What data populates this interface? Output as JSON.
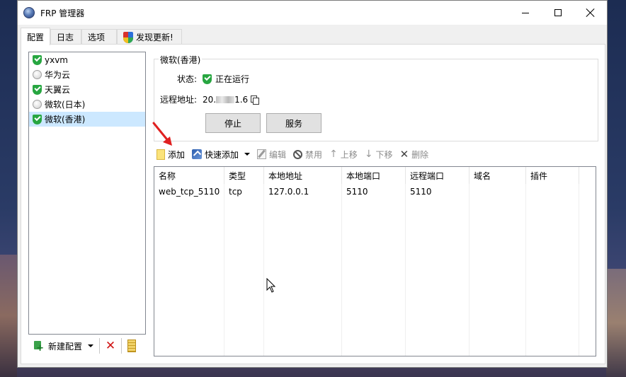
{
  "window": {
    "title": "FRP 管理器"
  },
  "tabs": [
    {
      "label": "配置"
    },
    {
      "label": "日志"
    },
    {
      "label": "选项"
    },
    {
      "label": "发现更新!"
    }
  ],
  "config_list": [
    {
      "name": "yxvm",
      "status": "running"
    },
    {
      "name": "华为云",
      "status": "stopped"
    },
    {
      "name": "天翼云",
      "status": "running"
    },
    {
      "name": "微软(日本)",
      "status": "stopped"
    },
    {
      "name": "微软(香港)",
      "status": "running",
      "selected": true
    }
  ],
  "left_toolbar": {
    "new_config_label": "新建配置"
  },
  "detail": {
    "group_title": "微软(香港)",
    "status_label": "状态:",
    "status_value": "正在运行",
    "remote_label": "远程地址:",
    "remote_prefix": "20.",
    "remote_suffix": "1.6",
    "stop_button": "停止",
    "service_button": "服务"
  },
  "proxy_toolbar": {
    "add": "添加",
    "quick_add": "快速添加",
    "edit": "编辑",
    "disable": "禁用",
    "move_up": "上移",
    "move_down": "下移",
    "delete": "删除"
  },
  "table": {
    "columns": [
      "名称",
      "类型",
      "本地地址",
      "本地端口",
      "远程端口",
      "域名",
      "插件"
    ],
    "rows": [
      [
        "web_tcp_5110",
        "tcp",
        "127.0.0.1",
        "5110",
        "5110",
        "",
        ""
      ]
    ]
  }
}
